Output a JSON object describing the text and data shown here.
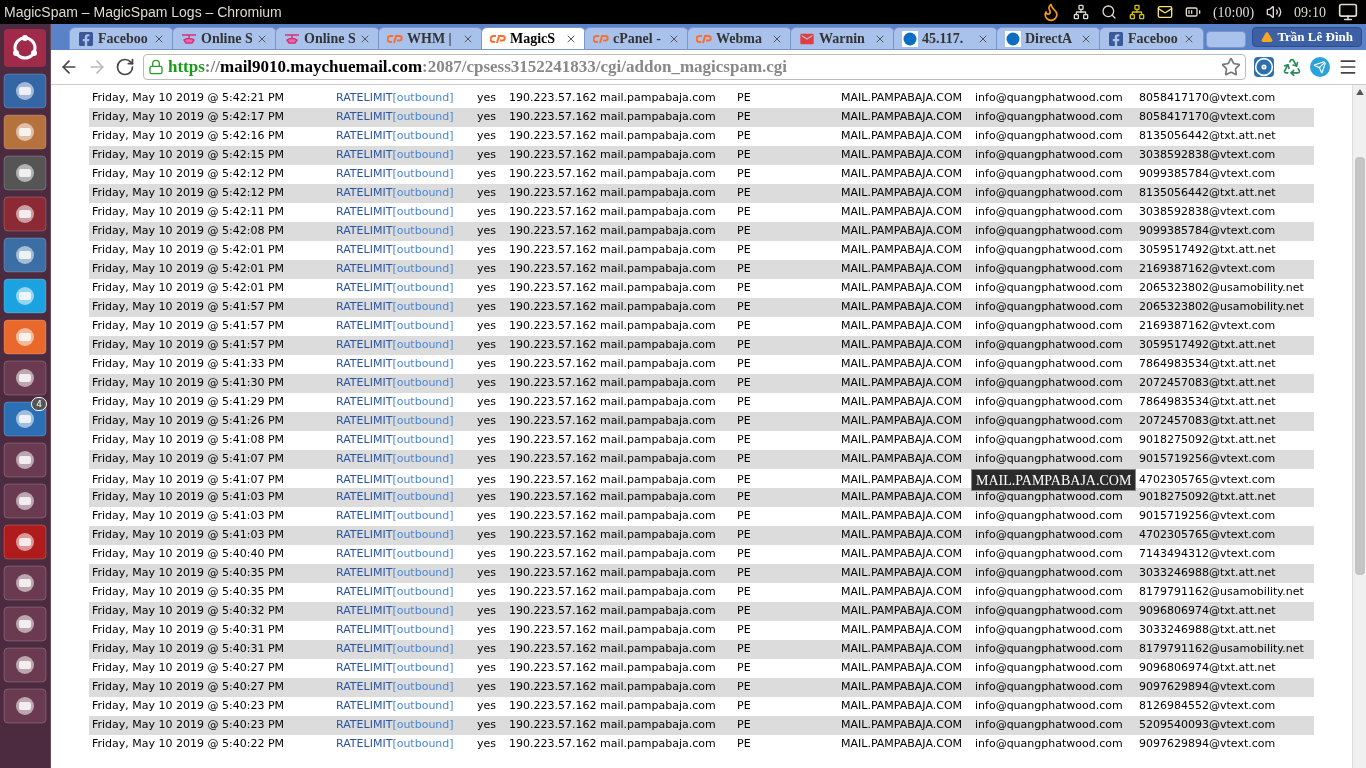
{
  "window": {
    "title": "MagicSpam – MagicSpam Logs – Chromium"
  },
  "panel": {
    "keyboard_layout": "(10:00)",
    "clock": "09:10"
  },
  "launcher": {
    "badge": "4"
  },
  "tabs": [
    {
      "label": "Faceboo",
      "kind": "facebook",
      "selected": false
    },
    {
      "label": "Online S",
      "kind": "heli",
      "selected": false
    },
    {
      "label": "Online S",
      "kind": "heli",
      "selected": false
    },
    {
      "label": "WHM |",
      "kind": "cpanel",
      "selected": false
    },
    {
      "label": "MagicS",
      "kind": "cpanel",
      "selected": true
    },
    {
      "label": "cPanel -",
      "kind": "cpanel",
      "selected": false
    },
    {
      "label": "Webma",
      "kind": "cpanel",
      "selected": false
    },
    {
      "label": "Warnin",
      "kind": "mail",
      "selected": false
    },
    {
      "label": "45.117.",
      "kind": "circle",
      "selected": false
    },
    {
      "label": "DirectA",
      "kind": "circle",
      "selected": false
    },
    {
      "label": "Faceboo",
      "kind": "facebook",
      "selected": false
    }
  ],
  "profile": {
    "name": "Trần Lê Đình"
  },
  "address_bar": {
    "scheme": "https",
    "separator": "://",
    "host": "mail9010.maychuemail.com",
    "path": ":2087/cpsess3152241833/cgi/addon_magicspam.cgi"
  },
  "log": {
    "rows": [
      {
        "time": "Friday, May 10 2019 @ 5:42:21 PM",
        "rule": "RATELIMIT",
        "scope": "[outbound]",
        "flag": "yes",
        "source": "190.223.57.162 mail.pampabaja.com",
        "country": "PE",
        "helo": "MAIL.PAMPABAJA.COM",
        "sender": "info@quangphatwood.com",
        "recipient": "8058417170@vtext.com"
      },
      {
        "time": "Friday, May 10 2019 @ 5:42:17 PM",
        "rule": "RATELIMIT",
        "scope": "[outbound]",
        "flag": "yes",
        "source": "190.223.57.162 mail.pampabaja.com",
        "country": "PE",
        "helo": "MAIL.PAMPABAJA.COM",
        "sender": "info@quangphatwood.com",
        "recipient": "8058417170@vtext.com"
      },
      {
        "time": "Friday, May 10 2019 @ 5:42:16 PM",
        "rule": "RATELIMIT",
        "scope": "[outbound]",
        "flag": "yes",
        "source": "190.223.57.162 mail.pampabaja.com",
        "country": "PE",
        "helo": "MAIL.PAMPABAJA.COM",
        "sender": "info@quangphatwood.com",
        "recipient": "8135056442@txt.att.net"
      },
      {
        "time": "Friday, May 10 2019 @ 5:42:15 PM",
        "rule": "RATELIMIT",
        "scope": "[outbound]",
        "flag": "yes",
        "source": "190.223.57.162 mail.pampabaja.com",
        "country": "PE",
        "helo": "MAIL.PAMPABAJA.COM",
        "sender": "info@quangphatwood.com",
        "recipient": "3038592838@vtext.com"
      },
      {
        "time": "Friday, May 10 2019 @ 5:42:12 PM",
        "rule": "RATELIMIT",
        "scope": "[outbound]",
        "flag": "yes",
        "source": "190.223.57.162 mail.pampabaja.com",
        "country": "PE",
        "helo": "MAIL.PAMPABAJA.COM",
        "sender": "info@quangphatwood.com",
        "recipient": "9099385784@vtext.com"
      },
      {
        "time": "Friday, May 10 2019 @ 5:42:12 PM",
        "rule": "RATELIMIT",
        "scope": "[outbound]",
        "flag": "yes",
        "source": "190.223.57.162 mail.pampabaja.com",
        "country": "PE",
        "helo": "MAIL.PAMPABAJA.COM",
        "sender": "info@quangphatwood.com",
        "recipient": "8135056442@txt.att.net"
      },
      {
        "time": "Friday, May 10 2019 @ 5:42:11 PM",
        "rule": "RATELIMIT",
        "scope": "[outbound]",
        "flag": "yes",
        "source": "190.223.57.162 mail.pampabaja.com",
        "country": "PE",
        "helo": "MAIL.PAMPABAJA.COM",
        "sender": "info@quangphatwood.com",
        "recipient": "3038592838@vtext.com"
      },
      {
        "time": "Friday, May 10 2019 @ 5:42:08 PM",
        "rule": "RATELIMIT",
        "scope": "[outbound]",
        "flag": "yes",
        "source": "190.223.57.162 mail.pampabaja.com",
        "country": "PE",
        "helo": "MAIL.PAMPABAJA.COM",
        "sender": "info@quangphatwood.com",
        "recipient": "9099385784@vtext.com"
      },
      {
        "time": "Friday, May 10 2019 @ 5:42:01 PM",
        "rule": "RATELIMIT",
        "scope": "[outbound]",
        "flag": "yes",
        "source": "190.223.57.162 mail.pampabaja.com",
        "country": "PE",
        "helo": "MAIL.PAMPABAJA.COM",
        "sender": "info@quangphatwood.com",
        "recipient": "3059517492@txt.att.net"
      },
      {
        "time": "Friday, May 10 2019 @ 5:42:01 PM",
        "rule": "RATELIMIT",
        "scope": "[outbound]",
        "flag": "yes",
        "source": "190.223.57.162 mail.pampabaja.com",
        "country": "PE",
        "helo": "MAIL.PAMPABAJA.COM",
        "sender": "info@quangphatwood.com",
        "recipient": "2169387162@vtext.com"
      },
      {
        "time": "Friday, May 10 2019 @ 5:42:01 PM",
        "rule": "RATELIMIT",
        "scope": "[outbound]",
        "flag": "yes",
        "source": "190.223.57.162 mail.pampabaja.com",
        "country": "PE",
        "helo": "MAIL.PAMPABAJA.COM",
        "sender": "info@quangphatwood.com",
        "recipient": "2065323802@usamobility.net"
      },
      {
        "time": "Friday, May 10 2019 @ 5:41:57 PM",
        "rule": "RATELIMIT",
        "scope": "[outbound]",
        "flag": "yes",
        "source": "190.223.57.162 mail.pampabaja.com",
        "country": "PE",
        "helo": "MAIL.PAMPABAJA.COM",
        "sender": "info@quangphatwood.com",
        "recipient": "2065323802@usamobility.net"
      },
      {
        "time": "Friday, May 10 2019 @ 5:41:57 PM",
        "rule": "RATELIMIT",
        "scope": "[outbound]",
        "flag": "yes",
        "source": "190.223.57.162 mail.pampabaja.com",
        "country": "PE",
        "helo": "MAIL.PAMPABAJA.COM",
        "sender": "info@quangphatwood.com",
        "recipient": "2169387162@vtext.com"
      },
      {
        "time": "Friday, May 10 2019 @ 5:41:57 PM",
        "rule": "RATELIMIT",
        "scope": "[outbound]",
        "flag": "yes",
        "source": "190.223.57.162 mail.pampabaja.com",
        "country": "PE",
        "helo": "MAIL.PAMPABAJA.COM",
        "sender": "info@quangphatwood.com",
        "recipient": "3059517492@txt.att.net"
      },
      {
        "time": "Friday, May 10 2019 @ 5:41:33 PM",
        "rule": "RATELIMIT",
        "scope": "[outbound]",
        "flag": "yes",
        "source": "190.223.57.162 mail.pampabaja.com",
        "country": "PE",
        "helo": "MAIL.PAMPABAJA.COM",
        "sender": "info@quangphatwood.com",
        "recipient": "7864983534@txt.att.net"
      },
      {
        "time": "Friday, May 10 2019 @ 5:41:30 PM",
        "rule": "RATELIMIT",
        "scope": "[outbound]",
        "flag": "yes",
        "source": "190.223.57.162 mail.pampabaja.com",
        "country": "PE",
        "helo": "MAIL.PAMPABAJA.COM",
        "sender": "info@quangphatwood.com",
        "recipient": "2072457083@txt.att.net"
      },
      {
        "time": "Friday, May 10 2019 @ 5:41:29 PM",
        "rule": "RATELIMIT",
        "scope": "[outbound]",
        "flag": "yes",
        "source": "190.223.57.162 mail.pampabaja.com",
        "country": "PE",
        "helo": "MAIL.PAMPABAJA.COM",
        "sender": "info@quangphatwood.com",
        "recipient": "7864983534@txt.att.net"
      },
      {
        "time": "Friday, May 10 2019 @ 5:41:26 PM",
        "rule": "RATELIMIT",
        "scope": "[outbound]",
        "flag": "yes",
        "source": "190.223.57.162 mail.pampabaja.com",
        "country": "PE",
        "helo": "MAIL.PAMPABAJA.COM",
        "sender": "info@quangphatwood.com",
        "recipient": "2072457083@txt.att.net"
      },
      {
        "time": "Friday, May 10 2019 @ 5:41:08 PM",
        "rule": "RATELIMIT",
        "scope": "[outbound]",
        "flag": "yes",
        "source": "190.223.57.162 mail.pampabaja.com",
        "country": "PE",
        "helo": "MAIL.PAMPABAJA.COM",
        "sender": "info@quangphatwood.com",
        "recipient": "9018275092@txt.att.net"
      },
      {
        "time": "Friday, May 10 2019 @ 5:41:07 PM",
        "rule": "RATELIMIT",
        "scope": "[outbound]",
        "flag": "yes",
        "source": "190.223.57.162 mail.pampabaja.com",
        "country": "PE",
        "helo": "MAIL.PAMPABAJA.COM",
        "sender": "info@quangphatwood.com",
        "recipient": "9015719256@vtext.com"
      },
      {
        "time": "Friday, May 10 2019 @ 5:41:07 PM",
        "rule": "RATELIMIT",
        "scope": "[outbound]",
        "flag": "yes",
        "source": "190.223.57.162 mail.pampabaja.com",
        "country": "PE",
        "helo": "MAIL.PAMPABAJA.COM",
        "tooltip": "MAIL.PAMPABAJA.COM",
        "recipient": "4702305765@vtext.com"
      },
      {
        "time": "Friday, May 10 2019 @ 5:41:03 PM",
        "rule": "RATELIMIT",
        "scope": "[outbound]",
        "flag": "yes",
        "source": "190.223.57.162 mail.pampabaja.com",
        "country": "PE",
        "helo": "MAIL.PAMPABAJA.COM",
        "sender": "info@quangphatwood.com",
        "recipient": "9018275092@txt.att.net"
      },
      {
        "time": "Friday, May 10 2019 @ 5:41:03 PM",
        "rule": "RATELIMIT",
        "scope": "[outbound]",
        "flag": "yes",
        "source": "190.223.57.162 mail.pampabaja.com",
        "country": "PE",
        "helo": "MAIL.PAMPABAJA.COM",
        "sender": "info@quangphatwood.com",
        "recipient": "9015719256@vtext.com"
      },
      {
        "time": "Friday, May 10 2019 @ 5:41:03 PM",
        "rule": "RATELIMIT",
        "scope": "[outbound]",
        "flag": "yes",
        "source": "190.223.57.162 mail.pampabaja.com",
        "country": "PE",
        "helo": "MAIL.PAMPABAJA.COM",
        "sender": "info@quangphatwood.com",
        "recipient": "4702305765@vtext.com"
      },
      {
        "time": "Friday, May 10 2019 @ 5:40:40 PM",
        "rule": "RATELIMIT",
        "scope": "[outbound]",
        "flag": "yes",
        "source": "190.223.57.162 mail.pampabaja.com",
        "country": "PE",
        "helo": "MAIL.PAMPABAJA.COM",
        "sender": "info@quangphatwood.com",
        "recipient": "7143494312@vtext.com"
      },
      {
        "time": "Friday, May 10 2019 @ 5:40:35 PM",
        "rule": "RATELIMIT",
        "scope": "[outbound]",
        "flag": "yes",
        "source": "190.223.57.162 mail.pampabaja.com",
        "country": "PE",
        "helo": "MAIL.PAMPABAJA.COM",
        "sender": "info@quangphatwood.com",
        "recipient": "3033246988@txt.att.net"
      },
      {
        "time": "Friday, May 10 2019 @ 5:40:35 PM",
        "rule": "RATELIMIT",
        "scope": "[outbound]",
        "flag": "yes",
        "source": "190.223.57.162 mail.pampabaja.com",
        "country": "PE",
        "helo": "MAIL.PAMPABAJA.COM",
        "sender": "info@quangphatwood.com",
        "recipient": "8179791162@usamobility.net"
      },
      {
        "time": "Friday, May 10 2019 @ 5:40:32 PM",
        "rule": "RATELIMIT",
        "scope": "[outbound]",
        "flag": "yes",
        "source": "190.223.57.162 mail.pampabaja.com",
        "country": "PE",
        "helo": "MAIL.PAMPABAJA.COM",
        "sender": "info@quangphatwood.com",
        "recipient": "9096806974@txt.att.net"
      },
      {
        "time": "Friday, May 10 2019 @ 5:40:31 PM",
        "rule": "RATELIMIT",
        "scope": "[outbound]",
        "flag": "yes",
        "source": "190.223.57.162 mail.pampabaja.com",
        "country": "PE",
        "helo": "MAIL.PAMPABAJA.COM",
        "sender": "info@quangphatwood.com",
        "recipient": "3033246988@txt.att.net"
      },
      {
        "time": "Friday, May 10 2019 @ 5:40:31 PM",
        "rule": "RATELIMIT",
        "scope": "[outbound]",
        "flag": "yes",
        "source": "190.223.57.162 mail.pampabaja.com",
        "country": "PE",
        "helo": "MAIL.PAMPABAJA.COM",
        "sender": "info@quangphatwood.com",
        "recipient": "8179791162@usamobility.net"
      },
      {
        "time": "Friday, May 10 2019 @ 5:40:27 PM",
        "rule": "RATELIMIT",
        "scope": "[outbound]",
        "flag": "yes",
        "source": "190.223.57.162 mail.pampabaja.com",
        "country": "PE",
        "helo": "MAIL.PAMPABAJA.COM",
        "sender": "info@quangphatwood.com",
        "recipient": "9096806974@txt.att.net"
      },
      {
        "time": "Friday, May 10 2019 @ 5:40:27 PM",
        "rule": "RATELIMIT",
        "scope": "[outbound]",
        "flag": "yes",
        "source": "190.223.57.162 mail.pampabaja.com",
        "country": "PE",
        "helo": "MAIL.PAMPABAJA.COM",
        "sender": "info@quangphatwood.com",
        "recipient": "9097629894@vtext.com"
      },
      {
        "time": "Friday, May 10 2019 @ 5:40:23 PM",
        "rule": "RATELIMIT",
        "scope": "[outbound]",
        "flag": "yes",
        "source": "190.223.57.162 mail.pampabaja.com",
        "country": "PE",
        "helo": "MAIL.PAMPABAJA.COM",
        "sender": "info@quangphatwood.com",
        "recipient": "8126984552@vtext.com"
      },
      {
        "time": "Friday, May 10 2019 @ 5:40:23 PM",
        "rule": "RATELIMIT",
        "scope": "[outbound]",
        "flag": "yes",
        "source": "190.223.57.162 mail.pampabaja.com",
        "country": "PE",
        "helo": "MAIL.PAMPABAJA.COM",
        "sender": "info@quangphatwood.com",
        "recipient": "5209540093@vtext.com"
      },
      {
        "time": "Friday, May 10 2019 @ 5:40:22 PM",
        "rule": "RATELIMIT",
        "scope": "[outbound]",
        "flag": "yes",
        "source": "190.223.57.162 mail.pampabaja.com",
        "country": "PE",
        "helo": "MAIL.PAMPABAJA.COM",
        "sender": "info@quangphatwood.com",
        "recipient": "9097629894@vtext.com"
      }
    ]
  }
}
